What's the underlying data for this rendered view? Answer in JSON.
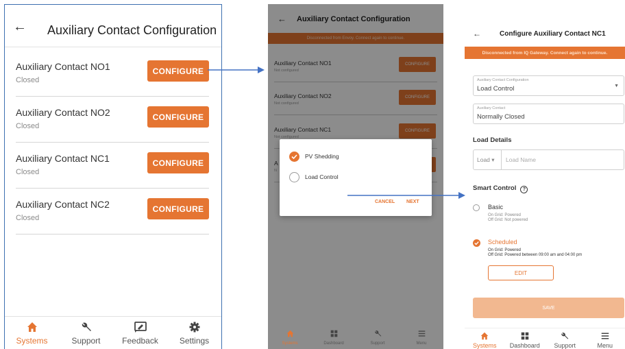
{
  "colors": {
    "accent": "#e57532",
    "frame": "#3c6fb0",
    "arrow": "#4472c4"
  },
  "screen1": {
    "back_icon": "arrow-left-icon",
    "title": "Auxiliary Contact Configuration",
    "contacts": [
      {
        "name": "Auxiliary Contact NO1",
        "status": "Closed",
        "button": "CONFIGURE"
      },
      {
        "name": "Auxiliary Contact NO2",
        "status": "Closed",
        "button": "CONFIGURE"
      },
      {
        "name": "Auxiliary Contact NC1",
        "status": "Closed",
        "button": "CONFIGURE"
      },
      {
        "name": "Auxiliary Contact NC2",
        "status": "Closed",
        "button": "CONFIGURE"
      }
    ],
    "tabs": [
      {
        "label": "Systems",
        "icon": "home-icon",
        "active": true
      },
      {
        "label": "Support",
        "icon": "wrench-icon",
        "active": false
      },
      {
        "label": "Feedback",
        "icon": "feedback-icon",
        "active": false
      },
      {
        "label": "Settings",
        "icon": "gear-icon",
        "active": false
      }
    ]
  },
  "screen2": {
    "back_icon": "arrow-left-icon",
    "title": "Auxiliary Contact Configuration",
    "banner": "Disconnected from Envoy. Connect again to continue.",
    "contacts": [
      {
        "name": "Auxiliary Contact NO1",
        "status": "Not configured",
        "button": "CONFIGURE"
      },
      {
        "name": "Auxiliary Contact NO2",
        "status": "Not configured",
        "button": "CONFIGURE"
      },
      {
        "name": "Auxiliary Contact NC1",
        "status": "Not configured",
        "button": "CONFIGURE"
      },
      {
        "name": "A",
        "status": "N",
        "button": ""
      }
    ],
    "dialog": {
      "options": [
        {
          "label": "PV Shedding",
          "selected": true
        },
        {
          "label": "Load Control",
          "selected": false
        }
      ],
      "cancel": "CANCEL",
      "next": "NEXT"
    },
    "tabs": [
      {
        "label": "Systems",
        "icon": "home-icon",
        "active": true
      },
      {
        "label": "Dashboard",
        "icon": "dashboard-icon",
        "active": false
      },
      {
        "label": "Support",
        "icon": "wrench-icon",
        "active": false
      },
      {
        "label": "Menu",
        "icon": "menu-icon",
        "active": false
      }
    ]
  },
  "screen3": {
    "back_icon": "arrow-left-icon",
    "title": "Configure Auxiliary Contact NC1",
    "banner": "Disconnected from IQ Gateway. Connect again to continue.",
    "config_field": {
      "label": "Auxiliary Contact Configuration",
      "value": "Load Control"
    },
    "contact_field": {
      "label": "Auxiliary Contact",
      "value": "Normally Closed"
    },
    "load_details": {
      "heading": "Load Details",
      "prefix": "Load",
      "placeholder": "Load Name"
    },
    "smart_control": {
      "heading": "Smart Control",
      "help_icon": "help-circle-icon",
      "basic": {
        "label": "Basic",
        "on_grid": "On Grid: Powered",
        "off_grid": "Off Grid: Not powered",
        "selected": false
      },
      "scheduled": {
        "label": "Scheduled",
        "on_grid": "On Grid: Powered",
        "off_grid": "Off Grid: Powered between 09:00 am and 04:00 pm",
        "selected": true
      },
      "edit": "EDIT"
    },
    "save": "SAVE",
    "tabs": [
      {
        "label": "Systems",
        "icon": "home-icon",
        "active": true
      },
      {
        "label": "Dashboard",
        "icon": "dashboard-icon",
        "active": false
      },
      {
        "label": "Support",
        "icon": "wrench-icon",
        "active": false
      },
      {
        "label": "Menu",
        "icon": "menu-icon",
        "active": false
      }
    ]
  }
}
